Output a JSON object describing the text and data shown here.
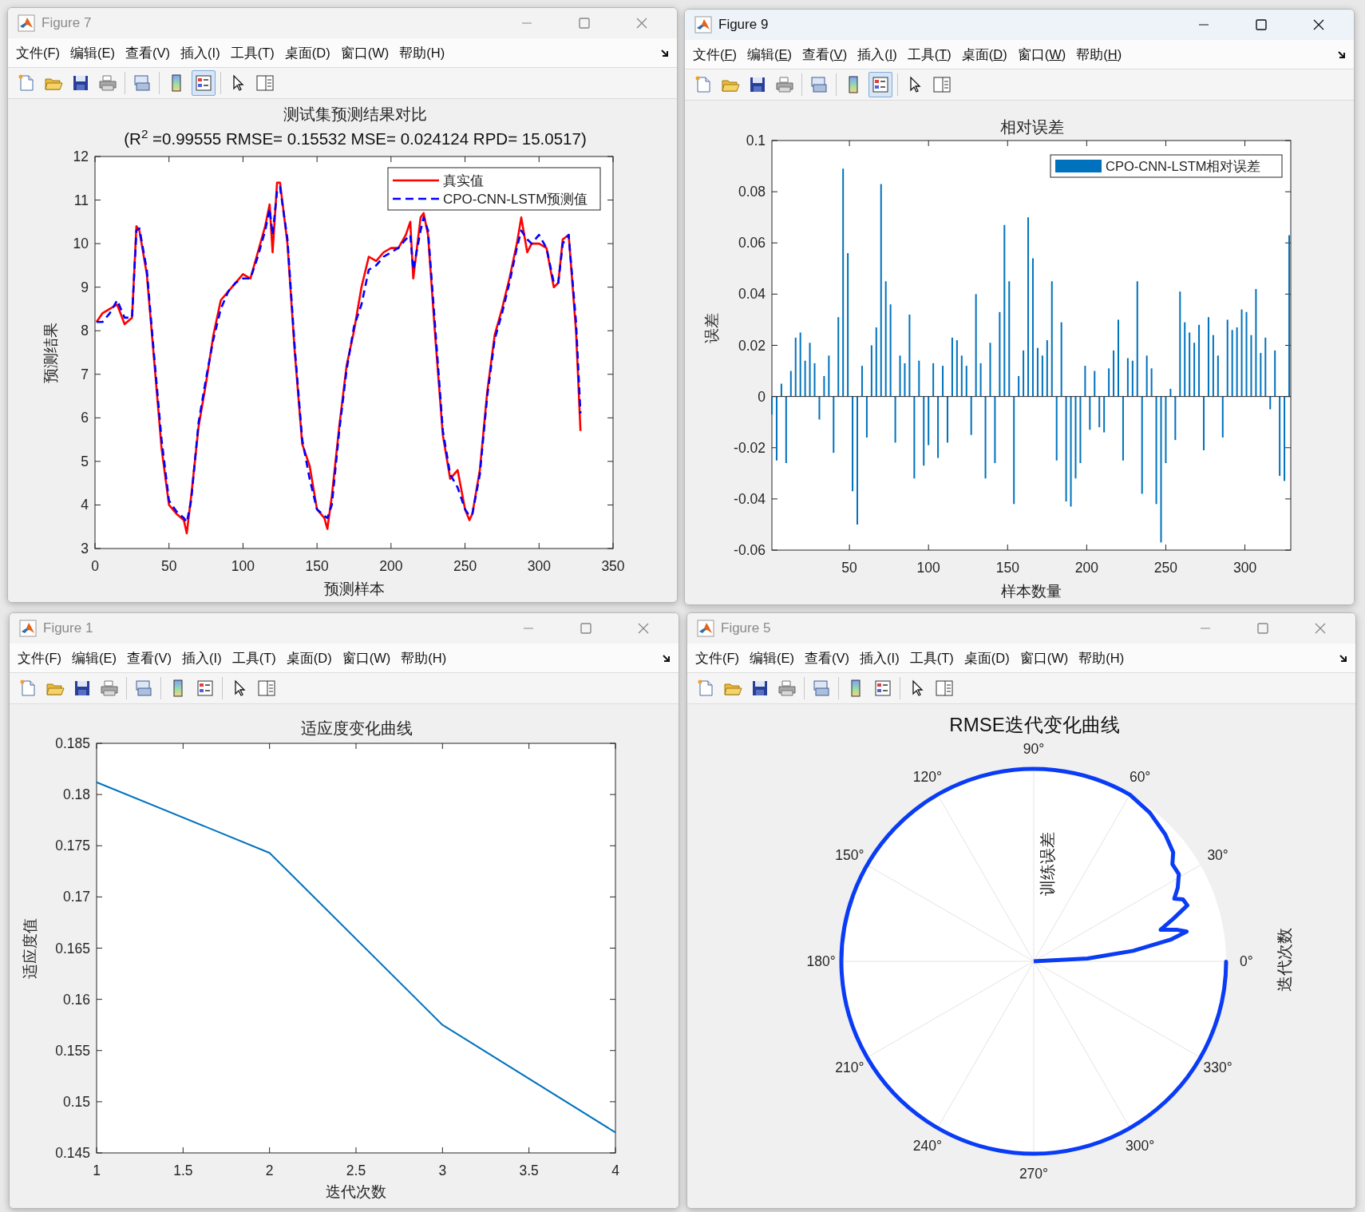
{
  "windows": [
    {
      "title": "Figure 7",
      "active": false,
      "menu": [
        "文件(F)",
        "编辑(E)",
        "查看(V)",
        "插入(I)",
        "工具(T)",
        "桌面(D)",
        "窗口(W)",
        "帮助(H)"
      ],
      "toolbar": {
        "legend_on": true
      },
      "figure": {
        "kind": "chart",
        "chart_data": {
          "type": "line",
          "legend": true,
          "title": "测试集预测结果对比",
          "subtitle": "(R$^{2}$ =0.99555 RMSE= 0.15532 MSE= 0.024124 RPD= 15.0517)",
          "xlabel": "预测样本",
          "ylabel": "预测结果",
          "x": [
            1,
            5,
            10,
            15,
            20,
            25,
            28,
            30,
            35,
            40,
            45,
            50,
            55,
            60,
            62,
            65,
            70,
            75,
            80,
            85,
            90,
            95,
            100,
            105,
            110,
            115,
            118,
            120,
            123,
            125,
            130,
            135,
            140,
            145,
            150,
            155,
            157,
            160,
            165,
            170,
            175,
            180,
            185,
            190,
            195,
            200,
            205,
            210,
            213,
            215,
            220,
            222,
            225,
            230,
            235,
            240,
            245,
            250,
            253,
            255,
            260,
            265,
            270,
            275,
            280,
            285,
            288,
            292,
            295,
            300,
            305,
            310,
            313,
            316,
            320,
            325,
            328
          ],
          "series": [
            {
              "name": "真实值",
              "color": "#ff0000",
              "line_style": "solid",
              "values": [
                8.2,
                8.4,
                8.5,
                8.6,
                8.15,
                8.3,
                10.4,
                10.3,
                9.3,
                7.3,
                5.3,
                4.0,
                3.8,
                3.65,
                3.35,
                4.2,
                5.8,
                6.8,
                7.9,
                8.7,
                8.9,
                9.1,
                9.3,
                9.2,
                9.8,
                10.4,
                10.9,
                9.8,
                11.4,
                11.4,
                10.0,
                7.5,
                5.4,
                4.9,
                3.9,
                3.7,
                3.45,
                4.2,
                5.8,
                7.2,
                8.0,
                9.0,
                9.7,
                9.6,
                9.8,
                9.9,
                9.9,
                10.2,
                10.5,
                9.2,
                10.6,
                10.7,
                10.2,
                7.8,
                5.6,
                4.6,
                4.8,
                3.9,
                3.65,
                3.8,
                4.8,
                6.6,
                7.9,
                8.5,
                9.2,
                10.0,
                10.6,
                9.8,
                10.0,
                10.0,
                9.9,
                9.0,
                9.1,
                10.1,
                10.2,
                8.0,
                5.7
              ]
            },
            {
              "name": "CPO-CNN-LSTM预测值",
              "color": "#0000ff",
              "line_style": "dashed",
              "values": [
                8.2,
                8.2,
                8.4,
                8.7,
                8.3,
                8.3,
                10.3,
                10.35,
                9.4,
                7.4,
                5.5,
                4.1,
                3.85,
                3.7,
                3.6,
                4.1,
                5.9,
                6.9,
                7.8,
                8.5,
                8.9,
                9.1,
                9.2,
                9.2,
                9.7,
                10.3,
                10.8,
                10.2,
                11.2,
                11.3,
                10.1,
                7.6,
                5.5,
                4.6,
                3.9,
                3.75,
                3.7,
                4.0,
                5.7,
                7.1,
                8.1,
                8.6,
                9.4,
                9.5,
                9.7,
                9.8,
                9.9,
                10.1,
                10.2,
                9.4,
                10.3,
                10.6,
                10.3,
                8.0,
                5.7,
                4.7,
                4.4,
                3.9,
                3.75,
                3.8,
                4.7,
                6.5,
                7.8,
                8.4,
                9.1,
                9.9,
                10.3,
                10.1,
                10.0,
                10.2,
                9.9,
                9.1,
                9.1,
                10.0,
                10.2,
                8.2,
                6.1
              ]
            }
          ],
          "xlim": [
            0,
            350
          ],
          "ylim": [
            3,
            12
          ],
          "xticks": [
            0,
            50,
            100,
            150,
            200,
            250,
            300,
            350
          ],
          "yticks": [
            3,
            4,
            5,
            6,
            7,
            8,
            9,
            10,
            11,
            12
          ]
        }
      }
    },
    {
      "title": "Figure 9",
      "active": true,
      "menu": [
        "文件(F)",
        "编辑(E)",
        "查看(V)",
        "插入(I)",
        "工具(T)",
        "桌面(D)",
        "窗口(W)",
        "帮助(H)"
      ],
      "toolbar": {
        "legend_on": true
      },
      "figure": {
        "kind": "chart",
        "chart_data": {
          "type": "bar",
          "legend": true,
          "title": "相对误差",
          "xlabel": "样本数量",
          "ylabel": "误差",
          "x": [
            1,
            4,
            7,
            10,
            13,
            16,
            19,
            22,
            25,
            28,
            31,
            34,
            37,
            40,
            43,
            46,
            49,
            52,
            55,
            58,
            61,
            64,
            67,
            70,
            73,
            76,
            79,
            82,
            85,
            88,
            91,
            94,
            97,
            100,
            103,
            106,
            109,
            112,
            115,
            118,
            121,
            124,
            127,
            130,
            133,
            136,
            139,
            142,
            145,
            148,
            151,
            154,
            157,
            160,
            163,
            166,
            169,
            172,
            175,
            178,
            181,
            184,
            187,
            190,
            193,
            196,
            199,
            202,
            205,
            208,
            211,
            214,
            217,
            220,
            223,
            226,
            229,
            232,
            235,
            238,
            241,
            244,
            247,
            250,
            253,
            256,
            259,
            262,
            265,
            268,
            271,
            274,
            277,
            280,
            283,
            286,
            289,
            292,
            295,
            298,
            301,
            304,
            307,
            310,
            313,
            316,
            319,
            322,
            325,
            328
          ],
          "series": [
            {
              "name": "CPO-CNN-LSTM相对误差",
              "color": "#0072bd",
              "values": [
                -0.007,
                -0.025,
                0.005,
                -0.026,
                0.01,
                0.023,
                0.025,
                0.014,
                0.021,
                0.013,
                -0.009,
                0.008,
                0.016,
                -0.022,
                0.031,
                0.089,
                0.056,
                -0.037,
                -0.05,
                0.012,
                -0.016,
                0.02,
                0.027,
                0.083,
                0.045,
                0.036,
                -0.018,
                0.016,
                0.013,
                0.032,
                -0.032,
                0.014,
                -0.027,
                -0.019,
                0.013,
                -0.024,
                0.012,
                -0.018,
                0.023,
                0.022,
                0.016,
                0.012,
                -0.015,
                0.04,
                0.013,
                -0.032,
                0.021,
                -0.026,
                0.033,
                0.067,
                0.045,
                -0.042,
                0.008,
                0.018,
                0.07,
                0.054,
                0.019,
                0.016,
                0.022,
                0.045,
                -0.025,
                0.029,
                -0.041,
                -0.043,
                -0.032,
                -0.026,
                0.012,
                -0.013,
                0.01,
                -0.012,
                -0.014,
                0.011,
                0.018,
                0.03,
                -0.025,
                0.015,
                0.014,
                0.045,
                -0.038,
                0.016,
                0.011,
                -0.042,
                -0.057,
                -0.026,
                0.003,
                -0.017,
                0.041,
                0.029,
                0.025,
                0.021,
                0.028,
                -0.021,
                0.031,
                0.024,
                0.016,
                -0.016,
                0.03,
                0.026,
                0.027,
                0.034,
                0.033,
                0.024,
                0.042,
                0.017,
                0.023,
                -0.005,
                0.018,
                -0.031,
                -0.033,
                0.063
              ]
            }
          ],
          "xlim": [
            1,
            329
          ],
          "ylim": [
            -0.06,
            0.1
          ],
          "xticks": [
            50,
            100,
            150,
            200,
            250,
            300
          ],
          "yticks": [
            -0.06,
            -0.04,
            -0.02,
            0,
            0.02,
            0.04,
            0.06,
            0.08,
            0.1
          ]
        }
      }
    },
    {
      "title": "Figure 1",
      "active": false,
      "menu": [
        "文件(F)",
        "编辑(E)",
        "查看(V)",
        "插入(I)",
        "工具(T)",
        "桌面(D)",
        "窗口(W)",
        "帮助(H)"
      ],
      "toolbar": {
        "legend_on": false
      },
      "figure": {
        "kind": "chart",
        "chart_data": {
          "type": "line",
          "title": "适应度变化曲线",
          "xlabel": "迭代次数",
          "ylabel": "适应度值",
          "x": [
            1,
            2,
            3,
            4
          ],
          "series": [
            {
              "color": "#0072bd",
              "line_style": "solid",
              "values": [
                0.1812,
                0.1743,
                0.1575,
                0.147
              ]
            }
          ],
          "xlim": [
            1,
            4
          ],
          "ylim": [
            0.145,
            0.185
          ],
          "xticks": [
            1,
            1.5,
            2,
            2.5,
            3,
            3.5,
            4
          ],
          "yticks": [
            0.145,
            0.15,
            0.155,
            0.16,
            0.165,
            0.17,
            0.175,
            0.18,
            0.185
          ]
        }
      }
    },
    {
      "title": "Figure 5",
      "active": false,
      "menu": [
        "文件(F)",
        "编辑(E)",
        "查看(V)",
        "插入(I)",
        "工具(T)",
        "桌面(D)",
        "窗口(W)",
        "帮助(H)"
      ],
      "toolbar": {
        "legend_on": false
      },
      "figure": {
        "kind": "polar",
        "title": "RMSE迭代变化曲线",
        "angle_labels": [
          "0°",
          "30°",
          "60°",
          "90°",
          "120°",
          "150°",
          "180°",
          "210°",
          "240°",
          "270°",
          "300°",
          "330°"
        ],
        "r_label": "训练误差",
        "theta_label": "迭代次数"
      }
    }
  ]
}
